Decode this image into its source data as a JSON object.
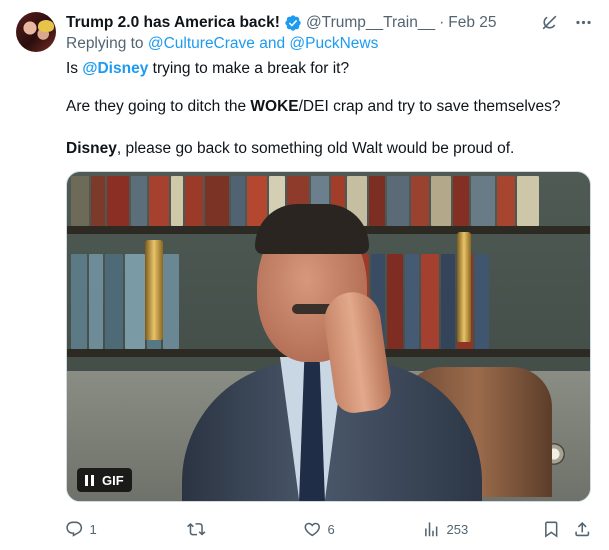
{
  "author": {
    "display_name": "Trump 2.0 has America back!",
    "handle": "@Trump__Train__",
    "separator": "·",
    "date": "Feb 25",
    "avatar_icon": "user-avatar"
  },
  "replying": {
    "prefix": "Replying to",
    "mention_1": "@CultureCrave",
    "conjunction": "and",
    "mention_2": "@PuckNews"
  },
  "body": {
    "line1_prefix": "Is",
    "line1_mention": "@Disney",
    "line1_suffix": "trying to make a break for it?",
    "line2_prefix": "Are they going to ditch the",
    "line2_bold": "WOKE",
    "line2_suffix": "/DEI crap and try to save themselves?",
    "line3_bold": "Disney",
    "line3_suffix": ", please go back to something old Walt would be proud of."
  },
  "media": {
    "badge_label": "GIF",
    "badge_icon": "pause-icon"
  },
  "actions": {
    "reply_count": "1",
    "retweet_count": "",
    "like_count": "6",
    "views_count": "253"
  },
  "colors": {
    "accent": "#1d9bf0",
    "secondary_text": "#536471",
    "primary_text": "#0f1419"
  }
}
